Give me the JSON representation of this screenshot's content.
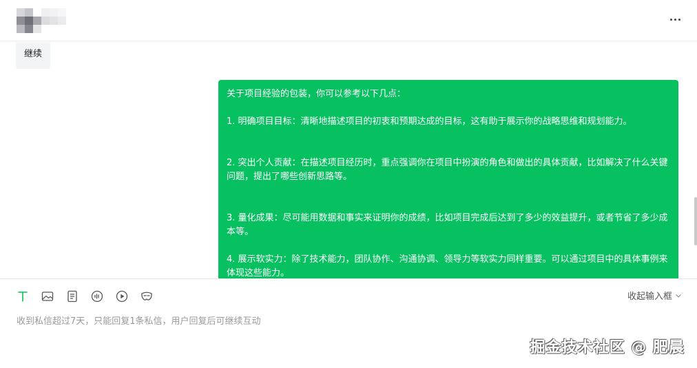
{
  "header": {
    "more_icon": "more-horizontal-icon"
  },
  "chat": {
    "previous_message": "继续",
    "message": {
      "intro": "关于项目经验的包装，你可以参考以下几点：",
      "point1": "1. 明确项目目标：清晰地描述项目的初衷和预期达成的目标，这有助于展示你的战略思维和规划能力。",
      "point2": "2. 突出个人贡献：在描述项目经历时，重点强调你在项目中扮演的角色和做出的具体贡献，比如解决了什么关键问题，提出了哪些创新思路等。",
      "point3": "3. 量化成果：尽可能用数据和事实来证明你的成绩，比如项目完成后达到了多少的效益提升，或者节省了多少成本等。",
      "point4": "4. 展示软实力：除了技术能力，团队协作、沟通协调、领导力等软实力同样重要。可以通过项目中的具体事例来体现这些能力。",
      "bubble_color": "#07c160"
    }
  },
  "toolbar": {
    "tools": [
      "text-icon",
      "image-icon",
      "document-icon",
      "audio-icon",
      "video-icon",
      "mask-icon"
    ],
    "active_color": "#07c160",
    "collapse_label": "收起输入框",
    "notice": "收到私信超过7天，只能回复1条私信，用户回复后可继续互动"
  },
  "watermark": "掘金技术社区 @ 肥晨"
}
